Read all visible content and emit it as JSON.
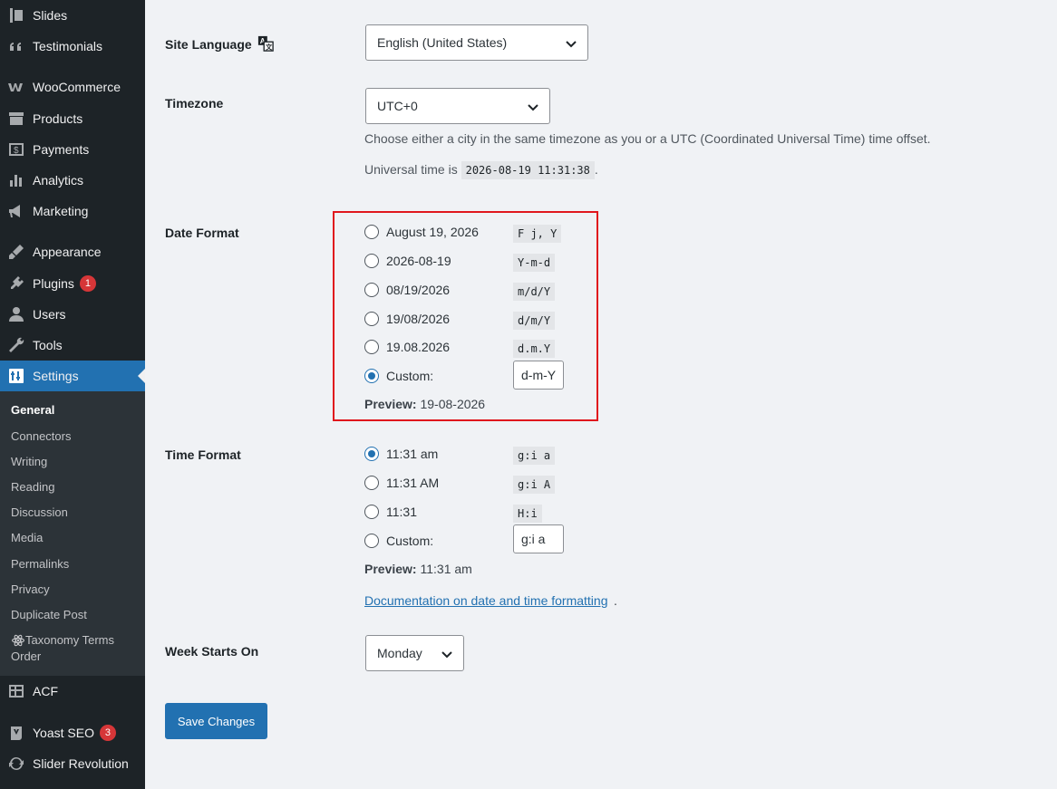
{
  "sidebar": {
    "items": [
      {
        "label": "Slides",
        "icon": "slides-icon"
      },
      {
        "label": "Testimonials",
        "icon": "quote-icon"
      },
      {
        "label": "WooCommerce",
        "icon": "woocommerce-icon"
      },
      {
        "label": "Products",
        "icon": "archive-icon"
      },
      {
        "label": "Payments",
        "icon": "payments-icon"
      },
      {
        "label": "Analytics",
        "icon": "bar-chart-icon"
      },
      {
        "label": "Marketing",
        "icon": "megaphone-icon"
      },
      {
        "label": "Appearance",
        "icon": "brush-icon"
      },
      {
        "label": "Plugins",
        "icon": "plugin-icon",
        "badge": "1"
      },
      {
        "label": "Users",
        "icon": "user-icon"
      },
      {
        "label": "Tools",
        "icon": "wrench-icon"
      },
      {
        "label": "Settings",
        "icon": "settings-icon"
      },
      {
        "label": "ACF",
        "icon": "table-icon"
      },
      {
        "label": "Yoast SEO",
        "icon": "yoast-icon",
        "badge": "3"
      },
      {
        "label": "Slider Revolution",
        "icon": "refresh-icon"
      }
    ],
    "submenu": [
      "General",
      "Connectors",
      "Writing",
      "Reading",
      "Discussion",
      "Media",
      "Permalinks",
      "Privacy",
      "Duplicate Post",
      "Taxonomy Terms Order"
    ]
  },
  "site_language": {
    "label": "Site Language",
    "value": "English (United States)"
  },
  "timezone": {
    "label": "Timezone",
    "value": "UTC+0",
    "description": "Choose either a city in the same timezone as you or a UTC (Coordinated Universal Time) time offset.",
    "universal_prefix": "Universal time is",
    "universal_value": "2026-08-19 11:31:38",
    "universal_suffix": "."
  },
  "date_format": {
    "label": "Date Format",
    "options": [
      {
        "label": "August 19, 2026",
        "code": "F j, Y"
      },
      {
        "label": "2026-08-19",
        "code": "Y-m-d"
      },
      {
        "label": "08/19/2026",
        "code": "m/d/Y"
      },
      {
        "label": "19/08/2026",
        "code": "d/m/Y"
      },
      {
        "label": "19.08.2026",
        "code": "d.m.Y"
      }
    ],
    "custom_label": "Custom:",
    "custom_value": "d-m-Y",
    "preview_label": "Preview:",
    "preview_value": "19-08-2026"
  },
  "time_format": {
    "label": "Time Format",
    "options": [
      {
        "label": "11:31 am",
        "code": "g:i a"
      },
      {
        "label": "11:31 AM",
        "code": "g:i A"
      },
      {
        "label": "11:31",
        "code": "H:i"
      }
    ],
    "custom_label": "Custom:",
    "custom_value": "g:i a",
    "preview_label": "Preview:",
    "preview_value": "11:31 am"
  },
  "doc_link": {
    "text": "Documentation on date and time formatting",
    "suffix": "."
  },
  "week_starts": {
    "label": "Week Starts On",
    "value": "Monday"
  },
  "save_button": "Save Changes",
  "colors": {
    "accent": "#2271b1",
    "highlight": "#e0171d",
    "sidebar": "#1d2327"
  }
}
